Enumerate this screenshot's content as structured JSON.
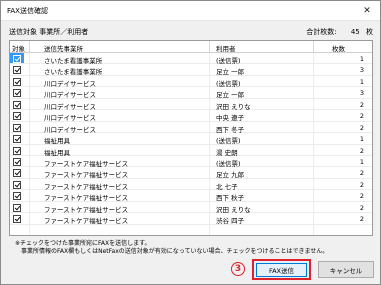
{
  "window": {
    "title": "FAX送信確認",
    "close_label": "✕"
  },
  "summary": {
    "label": "送信対象 事業所／利用者",
    "total_label": "合計枚数:",
    "total_value": "45",
    "total_unit": "枚"
  },
  "table": {
    "headers": {
      "check": "対象",
      "office": "送信先事業所",
      "user": "利用者",
      "count": "枚数"
    },
    "rows": [
      {
        "office": "さいたま看護事業所",
        "user": "(送信票)",
        "count": "1",
        "selected": true
      },
      {
        "office": "さいたま看護事業所",
        "user": "足立 一郎",
        "count": "3",
        "selected": false
      },
      {
        "office": "川口デイサービス",
        "user": "(送信票)",
        "count": "1",
        "selected": false
      },
      {
        "office": "川口デイサービス",
        "user": "足立 一郎",
        "count": "3",
        "selected": false
      },
      {
        "office": "川口デイサービス",
        "user": "沢田 えりな",
        "count": "2",
        "selected": false
      },
      {
        "office": "川口デイサービス",
        "user": "中央 遼子",
        "count": "2",
        "selected": false
      },
      {
        "office": "川口デイサービス",
        "user": "西下 冬子",
        "count": "2",
        "selected": false
      },
      {
        "office": "福祉用具",
        "user": "(送信票)",
        "count": "1",
        "selected": false
      },
      {
        "office": "福祉用具",
        "user": "湯 史朗",
        "count": "2",
        "selected": false
      },
      {
        "office": "ファーストケア福祉サービス",
        "user": "(送信票)",
        "count": "1",
        "selected": false
      },
      {
        "office": "ファーストケア福祉サービス",
        "user": "足立 九郎",
        "count": "2",
        "selected": false
      },
      {
        "office": "ファーストケア福祉サービス",
        "user": "北 七子",
        "count": "2",
        "selected": false
      },
      {
        "office": "ファーストケア福祉サービス",
        "user": "西下 秋子",
        "count": "2",
        "selected": false
      },
      {
        "office": "ファーストケア福祉サービス",
        "user": "沢田 えりな",
        "count": "2",
        "selected": false
      },
      {
        "office": "ファーストケア福祉サービス",
        "user": "渋谷 四子",
        "count": "2",
        "selected": false
      }
    ]
  },
  "notes": {
    "line1": "※チェックをつけた事業所宛にFAXを送信します。",
    "line2": "事業所情報のFAX欄もしくはNetFaxの送信対象が有効になっていない場合、チェックをつけることはできません。"
  },
  "marker": "3",
  "buttons": {
    "fax_send": "FAX送信",
    "cancel": "キャンセル"
  },
  "colors": {
    "highlight": "#e0202a",
    "selection": "#3399ff"
  }
}
